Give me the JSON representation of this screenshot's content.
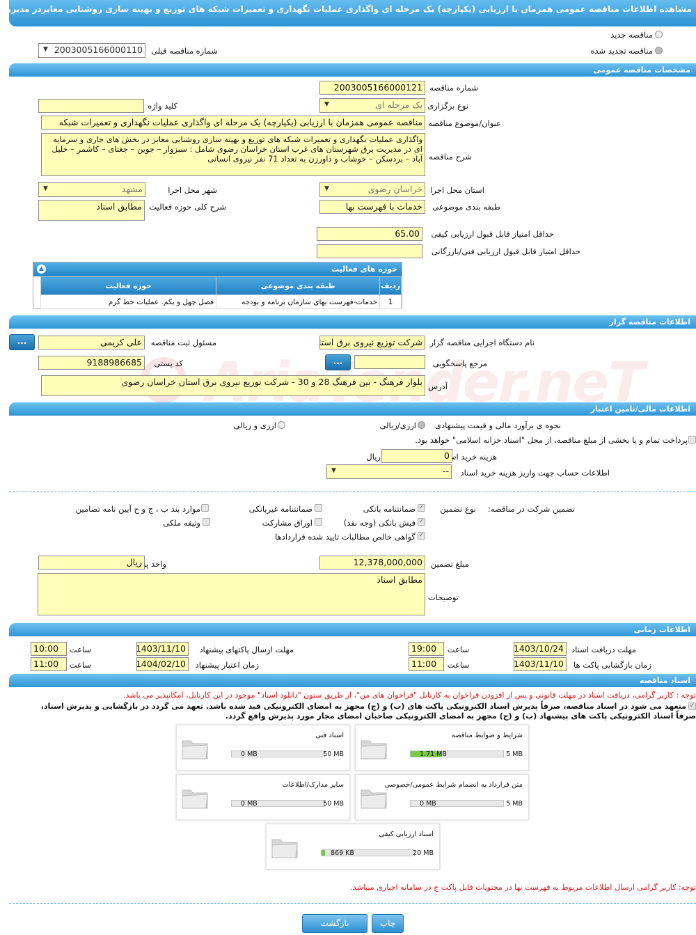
{
  "title": "مشاهده اطلاعات مناقصه عمومی همزمان با ارزیابی (یکپارچه) یک مرحله ای واگذاری عملیات نگهداری و تعمیرات شبکه های توزیع و بهینه سازی روشنایی معابردر مدیریت برق شهرستان غرب استان",
  "top": {
    "new_tender": "مناقصه جدید",
    "renewed_tender": "مناقصه تجدید شده",
    "prev_number_label": "شماره مناقصه قبلی",
    "prev_number_value": "2003005166000110"
  },
  "general": {
    "header": "مشخصات مناقصه عمومی",
    "number_label": "شماره مناقصه",
    "number_value": "2003005166000121",
    "type_label": "نوع برگزاری",
    "type_value": "یک مرحله ای",
    "keyword_label": "کلید واژه",
    "keyword_value": "",
    "subject_label": "عنوان/موضوع مناقصه",
    "subject_value": "مناقصه عمومی همزمان با ارزیابی (یکپارچه) یک مرحله ای واگذاری عملیات نگهداری و تعمیرات شبکه",
    "desc_label": "شرح مناقصه",
    "desc_value": "واگذاری عملیات نگهداری و تعمیرات شبکه های توزیع و بهینه سازی روشنایی معابر در بخش های جاری و سرمایه ای در مدیریت برق شهرستان های غرب  استان خراسان رضوی شامل : سبزوار – جوین – جغتای – کاشمر – خلیل آباد – بردسکن – خوشاب و داورزن  به تعداد 71 نفر نیروی انسانی",
    "province_label": "استان محل اجرا",
    "province_value": "خراسان رضوی",
    "city_label": "شهر محل اجرا",
    "city_value": "مشهد",
    "category_label": "طبقه بندی موضوعی",
    "category_value": "خدمات با فهرست بها",
    "activity_desc_label": "شرح کلی حوزه فعالیت",
    "activity_desc_value": "مطابق اسناد",
    "min_quality_label": "حداقل امتیاز قابل قبول ارزیابی کیفی",
    "min_quality_value": "65.00",
    "min_tech_label": "حداقل امتیاز قابل قبول ارزیابی فنی/بازرگانی",
    "min_tech_value": ""
  },
  "activity_table": {
    "title": "حوزه های فعالیت",
    "headers": [
      "ردیف",
      "طبقه بندی موضوعی",
      "حوزه فعالیت"
    ],
    "rows": [
      [
        "1",
        "خدمات-فهرست بهای سازمان برنامه و بودجه",
        "فصل چهل و یکم. عملیات خط گرم"
      ]
    ]
  },
  "tenderer": {
    "header": "اطلاعات مناقصه گزار",
    "org_label": "نام دستگاه اجرایی مناقصه گزار",
    "org_value": "شرکت توزیع نیروی برق استان خراسان رضوی",
    "registrar_label": "مسئول ثبت مناقصه",
    "registrar_value": "علی کریمی",
    "ref_label": "مرجع پاسخگویی",
    "ref_value": "",
    "postal_label": "کد پستی",
    "postal_value": "9188986685",
    "address_label": "آدرس",
    "address_value": "بلوار فرهنگ - بین فرهنگ 28 و 30 - شرکت توزیع نیروی برق استان خراسان رضوی",
    "dots": "..."
  },
  "finance": {
    "header": "اطلاعات مالی/تامین اعتبار",
    "estimate_label": "نحوه ی برآورد مالی و قیمت پیشنهادی",
    "opt1": "ارزی/ریالی",
    "opt2": "ارزی و ریالی",
    "treasury_text": "پرداخت تمام و یا بخشی از مبلغ مناقصه، از محل \"اسناد خزانه اسلامی\" خواهد بود.",
    "doc_fee_label": "هزینه خرید اسناد",
    "doc_fee_value": "0",
    "doc_fee_unit": "ریال",
    "account_label": "اطلاعات حساب جهت واریز هزینه خرید اسناد",
    "account_value": "--"
  },
  "guarantee": {
    "section_label": "تضمین شرکت در مناقصه:",
    "type_label": "نوع تضمین",
    "options": [
      "ضمانتنامه بانکی",
      "ضمانتنامه غیربانکی",
      "موارد بند ب ، ج و ح آیین نامه تضامین",
      "فیش بانکی (وجه نقد)",
      "اوراق مشارکت",
      "وثیقه ملکی",
      "گواهی خالص مطالبات تایید شده قراردادها"
    ],
    "amount_label": "مبلغ تضمین",
    "amount_value": "12,378,000,000",
    "currency_label": "واحد پول",
    "currency_value": "ریال",
    "notes_label": "توضیحات",
    "notes_value": "مطابق اسناد"
  },
  "timing": {
    "header": "اطلاعات زمانی",
    "receive_label": "مهلت دریافت اسناد",
    "receive_date": "1403/10/24",
    "receive_time": "19:00",
    "send_label": "مهلت ارسال پاکتهای پیشنهاد",
    "send_date": "1403/11/10",
    "send_time": "10:00",
    "open_label": "زمان بازگشایی پاکت ها",
    "open_date": "1403/11/10",
    "open_time": "11:00",
    "validity_label": "زمان اعتبار پیشنهاد",
    "validity_date": "1404/02/10",
    "validity_time": "11:00",
    "time_label": "ساعت"
  },
  "documents": {
    "header": "اسناد مناقصه",
    "note1": "توجه : کاربر گرامی، دریافت اسناد در مهلت قانونی و پس از افزودن فراخوان به کارتابل \"فراخوان های من\"، از طریق ستون \"دانلود اسناد\" موجود در این کارتابل، امکانپذیر می باشد.",
    "note2a": "متعهد می شود در اسناد مناقصه، صرفاً پذیرش اسناد الکترونیکی پاکت های (ب) و (ج) مجهز به امضای الکترونیکی قید شده باشد. تعهد می گردد در بازگشایی و پذیرش اسناد،",
    "note2b": "صرفاً اسناد الکترونیکی پاکت های پیشنهاد (ب) و (ج) مجهز به امضای الکترونیکی صاحبان امضای مجاز مورد پذیرش واقع گردد.",
    "files": [
      {
        "name": "شرایط و ضوابط مناقصه",
        "size": "1.71 MB",
        "max": "5 MB",
        "fill": 0.34
      },
      {
        "name": "اسناد فنی",
        "size": "0 MB",
        "max": "50 MB",
        "fill": 0
      },
      {
        "name": "متن قرارداد به انضمام شرایط عمومی/خصوصی",
        "size": "0 MB",
        "max": "5 MB",
        "fill": 0
      },
      {
        "name": "سایر مدارک/اطلاعات",
        "size": "0 MB",
        "max": "50 MB",
        "fill": 0
      },
      {
        "name": "اسناد ارزیابی کیفی",
        "size": "869 KB",
        "max": "20 MB",
        "fill": 0.04
      }
    ],
    "note3": "توجه: کاربر گرامی ارسال اطلاعات مربوط به فهرست بها در محتویات فایل پاکت ج در سامانه اجباری میباشد."
  },
  "buttons": {
    "print": "چاپ",
    "back": "بازگشت"
  },
  "watermark": "AriaTender.neT"
}
